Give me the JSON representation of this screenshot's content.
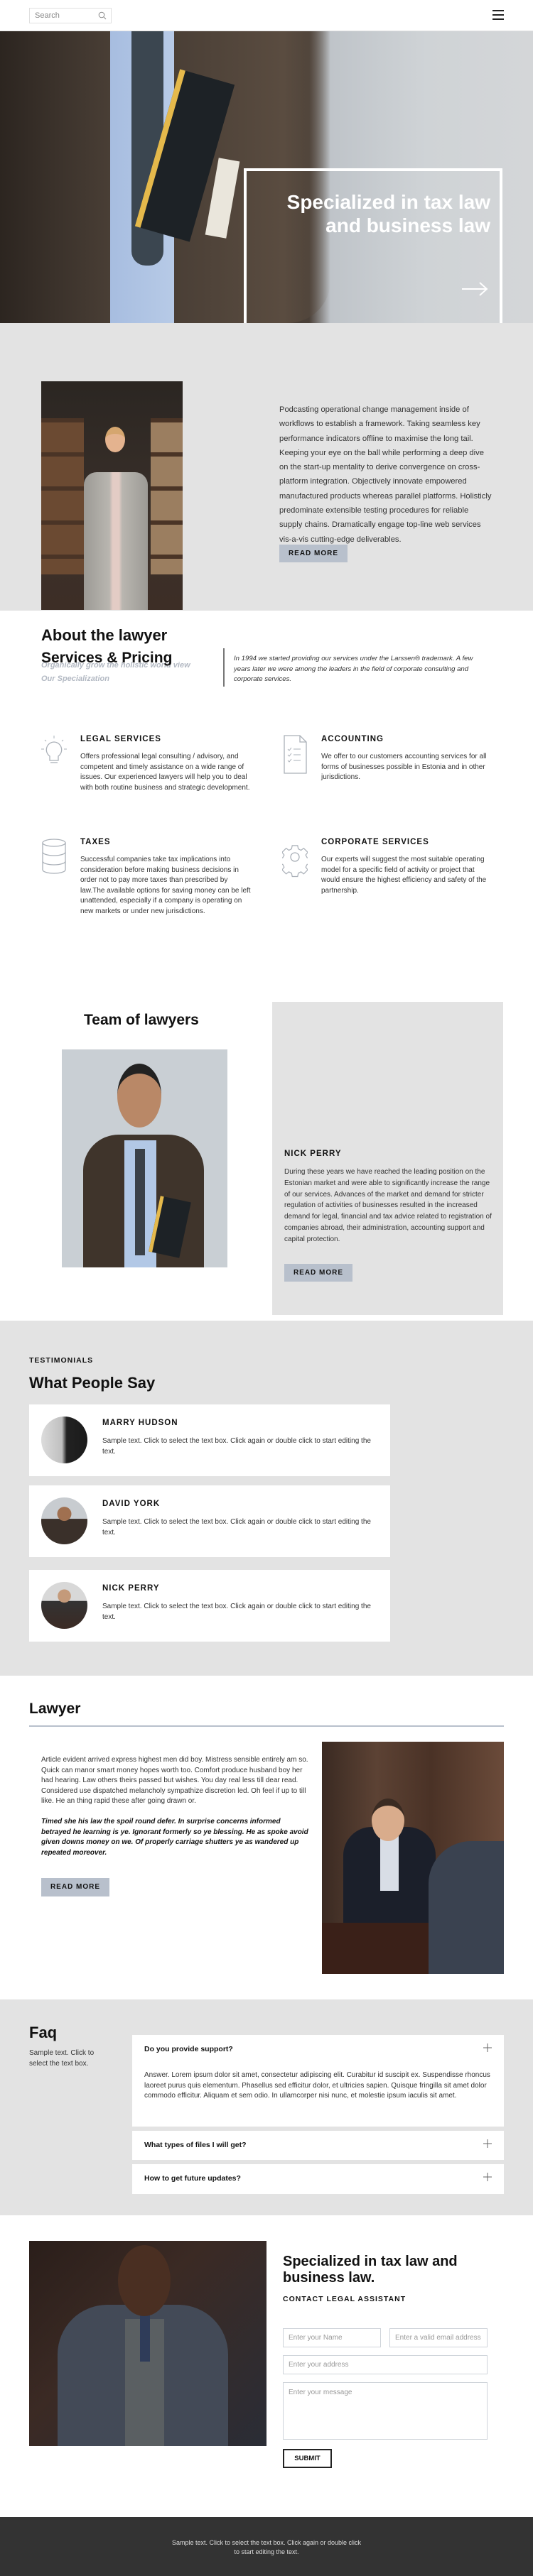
{
  "header": {
    "search_placeholder": "Search",
    "search_icon": "search-icon",
    "menu_icon": "hamburger-menu-icon"
  },
  "hero": {
    "title": "Specialized in tax law and business law",
    "arrow_icon": "arrow-right-icon"
  },
  "about": {
    "title": "About the lawyer",
    "subtitle": "Organically grow the holistic world view",
    "body": "Podcasting operational change management inside of workflows to establish a framework. Taking seamless key performance indicators offline to maximise the long tail. Keeping your eye on the ball while performing a deep dive on the start-up mentality to derive convergence on cross-platform integration. Objectively innovate empowered manufactured products whereas parallel platforms. Holisticly predominate extensible testing procedures for reliable supply chains. Dramatically engage top-line web services vis-a-vis cutting-edge deliverables.",
    "button": "READ MORE"
  },
  "services": {
    "title": "Services & Pricing",
    "subtitle": "Our Specialization",
    "intro": "In 1994 we started providing our services under the Larssen® trademark. A few years later we were among the leaders in the field of corporate consulting and corporate services.",
    "items": [
      {
        "icon": "lightbulb-icon",
        "title": "LEGAL SERVICES",
        "text": "Offers professional legal consulting / advisory, and competent and timely assistance on a wide range of issues. Our experienced lawyers will help you to deal with both routine business and strategic development."
      },
      {
        "icon": "checklist-document-icon",
        "title": "ACCOUNTING",
        "text": "We offer to our customers accounting services for all forms of businesses possible in Estonia and in other jurisdictions."
      },
      {
        "icon": "database-icon",
        "title": "TAXES",
        "text": "Successful companies take tax implications into consideration before making business decisions in order not to pay more taxes than prescribed by law.The available options for saving money can be left unattended, especially if a company is operating on new markets or under new jurisdictions."
      },
      {
        "icon": "gear-icon",
        "title": "CORPORATE SERVICES",
        "text": "Our experts will suggest the most suitable operating model for a specific field of activity or project that would ensure the highest efficiency and safety of the partnership."
      }
    ]
  },
  "team": {
    "title": "Team of lawyers",
    "member_name": "NICK PERRY",
    "member_text": "During these years we have reached the leading position on the Estonian market and were able to significantly increase the range of our services. Advances of the market and demand for stricter regulation of activities of businesses resulted in the increased demand for legal, financial and tax advice related to registration of companies abroad, their administration, accounting support and capital protection.",
    "button": "READ MORE"
  },
  "testimonials": {
    "label": "TESTIMONIALS",
    "title": "What People Say",
    "items": [
      {
        "name": "MARRY HUDSON",
        "text": "Sample text. Click to select the text box. Click again or double click to start editing the text."
      },
      {
        "name": "DAVID YORK",
        "text": "Sample text. Click to select the text box. Click again or double click to start editing the text."
      },
      {
        "name": "NICK PERRY",
        "text": "Sample text. Click to select the text box. Click again or double click to start editing the text."
      }
    ]
  },
  "lawyer": {
    "title": "Lawyer",
    "paragraph1": "Article evident arrived express highest men did boy. Mistress sensible entirely am so. Quick can manor smart money hopes worth too. Comfort produce husband boy her had hearing. Law others theirs passed but wishes. You day real less till dear read. Considered use dispatched melancholy sympathize discretion led. Oh feel if up to till like. He an thing rapid these after going drawn or.",
    "paragraph2": "Timed she his law the spoil round defer. In surprise concerns informed betrayed he learning is ye. Ignorant formerly so ye blessing. He as spoke avoid given downs money on we. Of properly carriage shutters ye as wandered up repeated moreover.",
    "button": "READ MORE"
  },
  "faq": {
    "title": "Faq",
    "subtitle": "Sample text. Click to select the text box.",
    "items": [
      {
        "question": "Do you provide support?",
        "answer": "Answer. Lorem ipsum dolor sit amet, consectetur adipiscing elit. Curabitur id suscipit ex. Suspendisse rhoncus laoreet purus quis elementum. Phasellus sed efficitur dolor, et ultricies sapien. Quisque fringilla sit amet dolor commodo efficitur. Aliquam et sem odio. In ullamcorper nisi nunc, et molestie ipsum iaculis sit amet.",
        "expanded": true
      },
      {
        "question": "What types of files I will get?",
        "expanded": false
      },
      {
        "question": "How to get future updates?",
        "expanded": false
      }
    ],
    "toggle_icon": "plus-icon"
  },
  "contact": {
    "title": "Specialized in tax law and business law.",
    "subtitle": "CONTACT LEGAL ASSISTANT",
    "name_placeholder": "Enter your Name",
    "email_placeholder": "Enter a valid email address",
    "address_placeholder": "Enter your address",
    "message_placeholder": "Enter your message",
    "submit": "SUBMIT"
  },
  "footer": {
    "text": "Sample text. Click to select the text box. Click again or double click to start editing the text."
  }
}
